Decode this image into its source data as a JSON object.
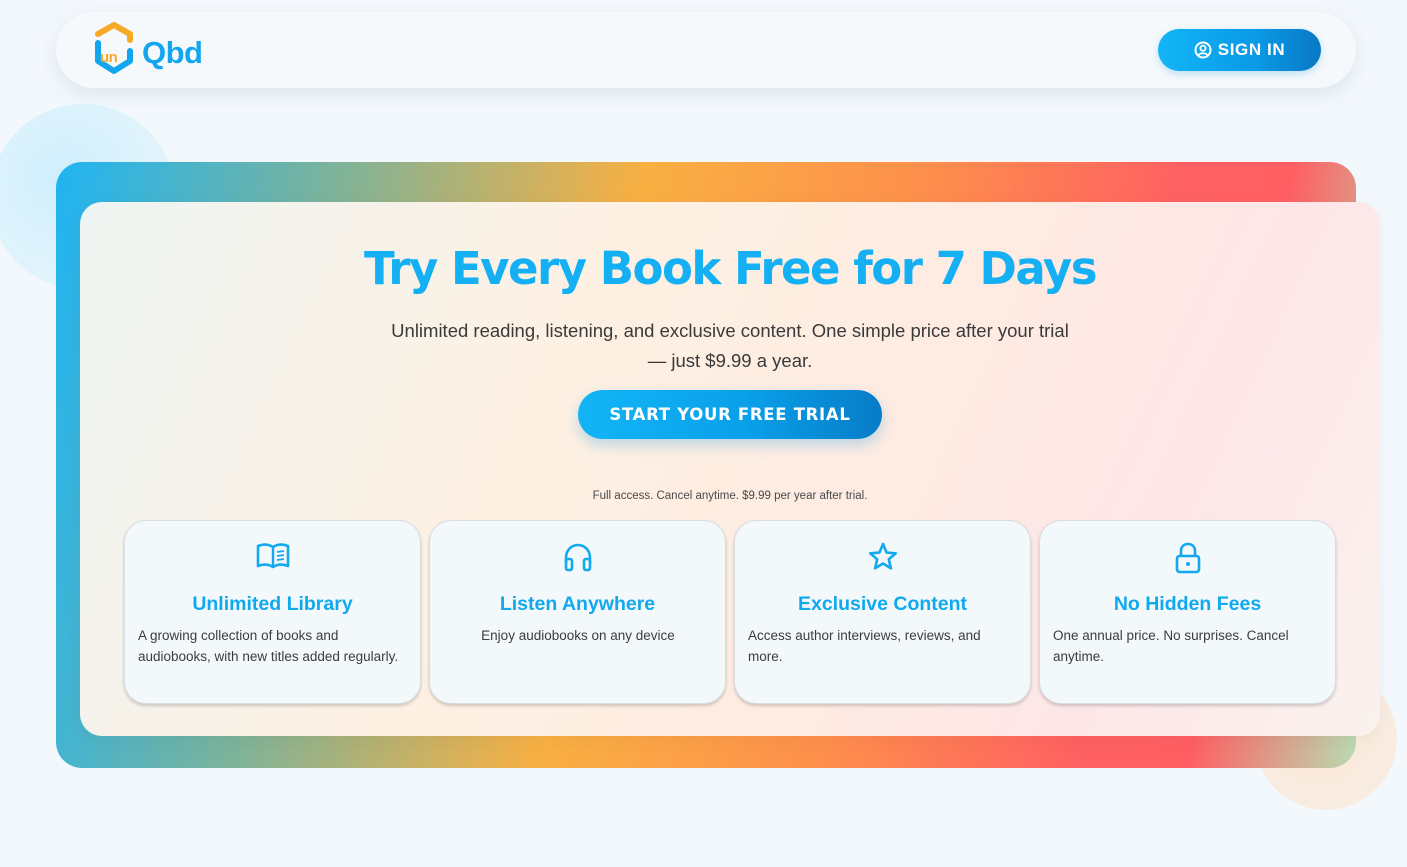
{
  "header": {
    "logo": {
      "mark_text": "un",
      "word_text": "Qbd"
    },
    "sign_in_label": "SIGN IN",
    "sign_in_icon": "user-circle-icon"
  },
  "hero": {
    "title": "Try Every Book Free for 7 Days",
    "subtitle": "Unlimited reading, listening, and exclusive content. One simple price after your trial — just $9.99 a year.",
    "cta_label": "START YOUR FREE TRIAL",
    "fine_print": "Full access. Cancel anytime. $9.99 per year after trial."
  },
  "features": [
    {
      "icon": "book-open-icon",
      "title": "Unlimited Library",
      "description": "A growing collection of books and audiobooks, with new titles added regularly."
    },
    {
      "icon": "headphones-icon",
      "title": "Listen Anywhere",
      "description": "Enjoy audiobooks on any device"
    },
    {
      "icon": "star-icon",
      "title": "Exclusive Content",
      "description": "Access author interviews, reviews, and more."
    },
    {
      "icon": "lock-icon",
      "title": "No Hidden Fees",
      "description": "One annual price. No surprises. Cancel anytime."
    }
  ],
  "colors": {
    "accent": "#14b0f3",
    "accent_dark": "#087cc7",
    "logo_orange": "#f7a928",
    "text": "#3a3a3a"
  }
}
